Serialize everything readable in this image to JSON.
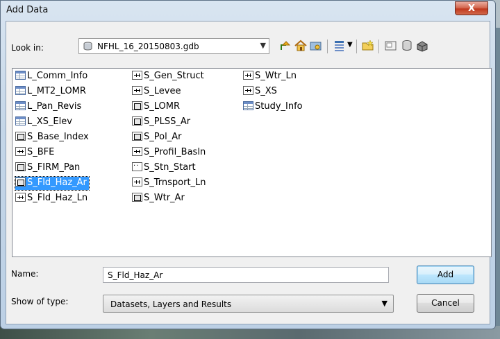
{
  "window": {
    "title": "Add Data",
    "close_glyph": "X"
  },
  "lookin": {
    "label": "Look in:",
    "value": "NFHL_16_20150803.gdb",
    "icon": "geodatabase-icon"
  },
  "toolbar": [
    "up-one-level-icon",
    "home-icon",
    "connect-folder-icon",
    "view-list-icon",
    "new-folder-icon",
    "catalog-icon",
    "new-geodatabase-icon",
    "toolbox-icon"
  ],
  "files": [
    {
      "name": "L_Comm_Info",
      "type": "table"
    },
    {
      "name": "L_MT2_LOMR",
      "type": "table"
    },
    {
      "name": "L_Pan_Revis",
      "type": "table"
    },
    {
      "name": "L_XS_Elev",
      "type": "table"
    },
    {
      "name": "S_Base_Index",
      "type": "polygon"
    },
    {
      "name": "S_BFE",
      "type": "line"
    },
    {
      "name": "S_FIRM_Pan",
      "type": "polygon"
    },
    {
      "name": "S_Fld_Haz_Ar",
      "type": "polygon",
      "selected": true
    },
    {
      "name": "S_Fld_Haz_Ln",
      "type": "line"
    },
    {
      "name": "S_Gen_Struct",
      "type": "line"
    },
    {
      "name": "S_Levee",
      "type": "line"
    },
    {
      "name": "S_LOMR",
      "type": "polygon"
    },
    {
      "name": "S_PLSS_Ar",
      "type": "polygon"
    },
    {
      "name": "S_Pol_Ar",
      "type": "polygon"
    },
    {
      "name": "S_Profil_Basln",
      "type": "line"
    },
    {
      "name": "S_Stn_Start",
      "type": "point"
    },
    {
      "name": "S_Trnsport_Ln",
      "type": "line"
    },
    {
      "name": "S_Wtr_Ar",
      "type": "polygon"
    },
    {
      "name": "S_Wtr_Ln",
      "type": "line"
    },
    {
      "name": "S_XS",
      "type": "line"
    },
    {
      "name": "Study_Info",
      "type": "table"
    }
  ],
  "name_field": {
    "label": "Name:",
    "value": "S_Fld_Haz_Ar"
  },
  "type_field": {
    "label": "Show of type:",
    "value": "Datasets, Layers and Results"
  },
  "buttons": {
    "add": "Add",
    "cancel": "Cancel"
  },
  "colors": {
    "selection": "#3399ff",
    "close": "#c0391e"
  }
}
